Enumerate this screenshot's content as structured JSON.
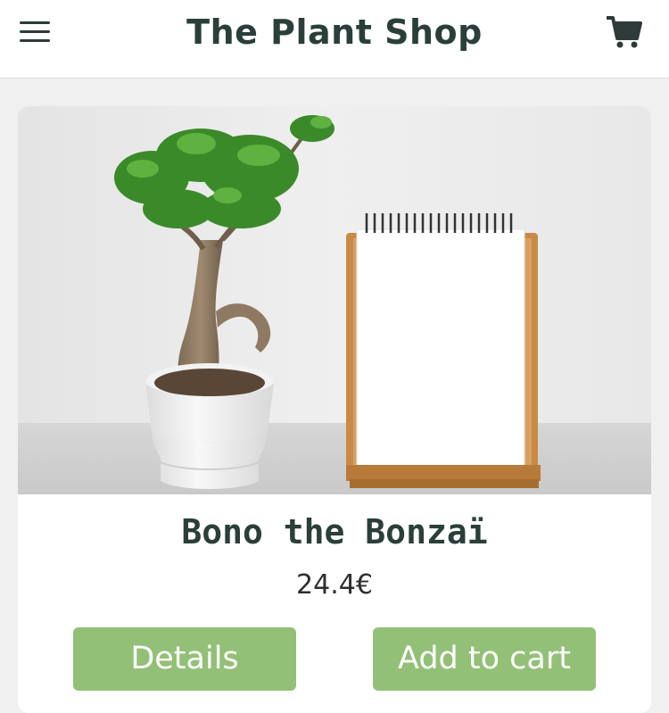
{
  "header": {
    "title": "The Plant Shop",
    "menu_icon": "hamburger-menu-icon",
    "cart_icon": "shopping-cart-icon"
  },
  "product": {
    "name": "Bono the Bonzaï",
    "price": "24.4€",
    "image_description": "bonsai-in-white-pot-next-to-notepad",
    "details_label": "Details",
    "add_to_cart_label": "Add to cart"
  },
  "colors": {
    "header_bg": "#ffffff",
    "page_bg": "#f0f0f0",
    "title_text": "#2b3f3a",
    "button_bg": "#93c077",
    "button_text": "#ffffff"
  }
}
